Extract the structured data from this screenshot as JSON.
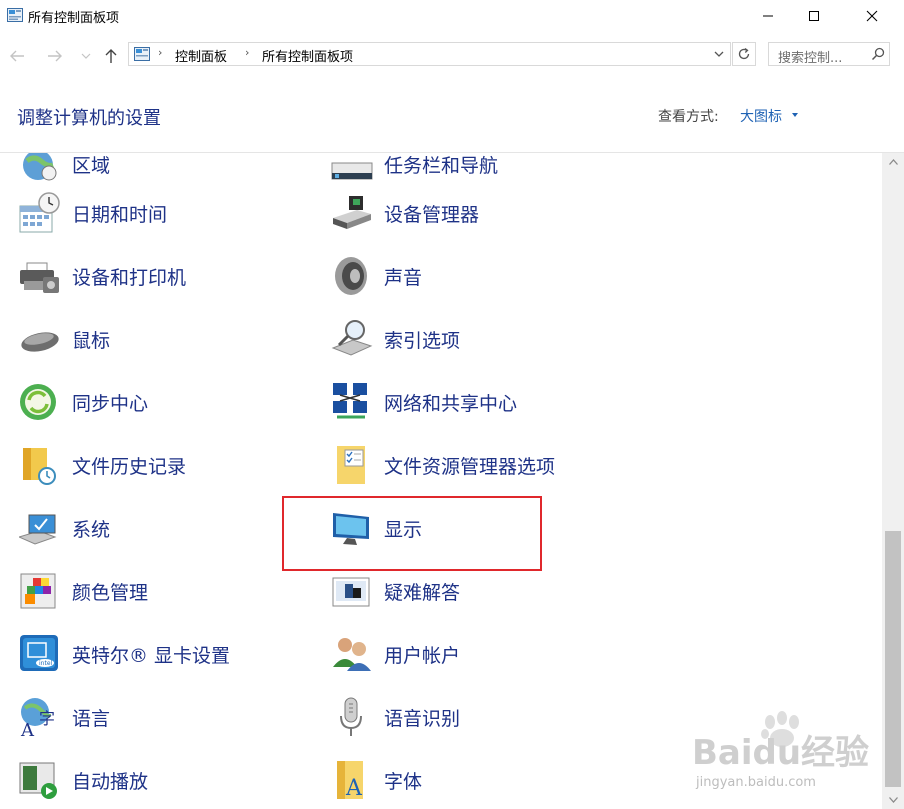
{
  "window": {
    "title": "所有控制面板项",
    "controls": [
      "minimize",
      "maximize",
      "close"
    ]
  },
  "address": {
    "breadcrumbs": [
      "控制面板",
      "所有控制面板项"
    ],
    "search_placeholder": "搜索控制..."
  },
  "header": {
    "title": "调整计算机的设置",
    "view_by_label": "查看方式:",
    "view_by_value": "大图标"
  },
  "items": [
    {
      "label": "区域",
      "icon": "region-icon"
    },
    {
      "label": "任务栏和导航",
      "icon": "taskbar-icon"
    },
    {
      "label": "日期和时间",
      "icon": "date-time-icon"
    },
    {
      "label": "设备管理器",
      "icon": "device-manager-icon"
    },
    {
      "label": "设备和打印机",
      "icon": "printer-icon"
    },
    {
      "label": "声音",
      "icon": "speaker-icon"
    },
    {
      "label": "鼠标",
      "icon": "mouse-icon"
    },
    {
      "label": "索引选项",
      "icon": "indexing-icon"
    },
    {
      "label": "同步中心",
      "icon": "sync-icon"
    },
    {
      "label": "网络和共享中心",
      "icon": "network-icon"
    },
    {
      "label": "文件历史记录",
      "icon": "file-history-icon"
    },
    {
      "label": "文件资源管理器选项",
      "icon": "folder-options-icon"
    },
    {
      "label": "系统",
      "icon": "system-icon"
    },
    {
      "label": "显示",
      "icon": "display-icon"
    },
    {
      "label": "颜色管理",
      "icon": "color-management-icon"
    },
    {
      "label": "疑难解答",
      "icon": "troubleshooting-icon"
    },
    {
      "label": "英特尔® 显卡设置",
      "icon": "intel-graphics-icon"
    },
    {
      "label": "用户帐户",
      "icon": "user-accounts-icon"
    },
    {
      "label": "语言",
      "icon": "language-icon"
    },
    {
      "label": "语音识别",
      "icon": "microphone-icon"
    },
    {
      "label": "自动播放",
      "icon": "autoplay-icon"
    },
    {
      "label": "字体",
      "icon": "fonts-icon"
    }
  ],
  "watermark": {
    "brand": "Baidu经验",
    "url": "jingyan.baidu.com"
  },
  "colors": {
    "link": "#1e3287",
    "highlight_box": "#e0282c"
  }
}
